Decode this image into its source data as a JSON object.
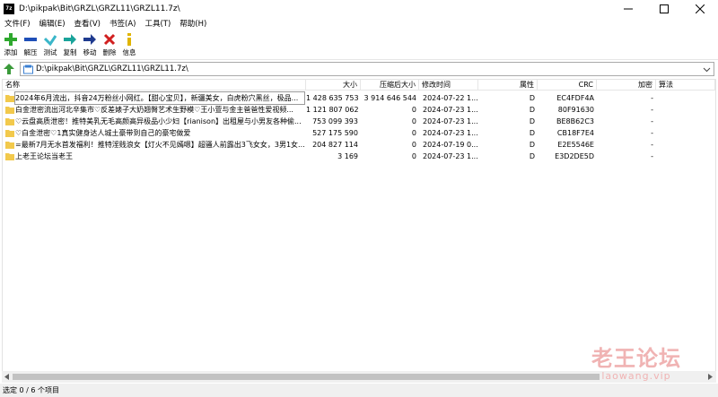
{
  "window": {
    "app_icon": "7z",
    "title": "D:\\pikpak\\Bit\\GRZL\\GRZL11\\GRZL11.7z\\"
  },
  "menu": [
    "文件(F)",
    "编辑(E)",
    "查看(V)",
    "书签(A)",
    "工具(T)",
    "帮助(H)"
  ],
  "toolbar": [
    {
      "label": "添加",
      "icon": "add-icon",
      "color": "#2ea82e"
    },
    {
      "label": "解压",
      "icon": "extract-icon",
      "color": "#1f4fb8"
    },
    {
      "label": "测试",
      "icon": "test-icon",
      "color": "#3ab6c9"
    },
    {
      "label": "复制",
      "icon": "copy-icon",
      "color": "#1aa39a"
    },
    {
      "label": "移动",
      "icon": "move-icon",
      "color": "#1f3b8f"
    },
    {
      "label": "删除",
      "icon": "delete-icon",
      "color": "#d11f1f"
    },
    {
      "label": "信息",
      "icon": "info-icon",
      "color": "#e0b400"
    }
  ],
  "address": {
    "path": "D:\\pikpak\\Bit\\GRZL\\GRZL11\\GRZL11.7z\\"
  },
  "columns": [
    "名称",
    "大小",
    "压缩后大小",
    "修改时间",
    "属性",
    "CRC",
    "加密",
    "算法"
  ],
  "rows": [
    {
      "name": "2024年6月流出，抖音24万粉丝小网红。【甜心宝贝】，新疆美女，白虎粉穴黑丝，极品...",
      "size": "1 428 635 753",
      "packed": "3 914 646 544",
      "modified": "2024-07-22 1...",
      "attr": "D",
      "crc": "EC4FDF4A",
      "encrypted": "-",
      "method": ""
    },
    {
      "name": "白金泄密流出河北辛集市♡反差婊子大奶翘臀艺术生野模♡王小萱与金主爸爸性爱视频...",
      "size": "1 121 807 062",
      "packed": "0",
      "modified": "2024-07-23 1...",
      "attr": "D",
      "crc": "80F91630",
      "encrypted": "-",
      "method": ""
    },
    {
      "name": "♡云盘高质泄密！推特美乳无毛高颜高异极品小少妇【rianison】出租屋与小男友各种偷...",
      "size": "753 099 393",
      "packed": "0",
      "modified": "2024-07-23 1...",
      "attr": "D",
      "crc": "BE8B62C3",
      "encrypted": "-",
      "method": ""
    },
    {
      "name": "♡白金泄密♡1真实健身达人城土豪带到自己的豪宅做爱",
      "size": "527 175 590",
      "packed": "0",
      "modified": "2024-07-23 1...",
      "attr": "D",
      "crc": "CB18F7E4",
      "encrypted": "-",
      "method": ""
    },
    {
      "name": "=最新7月无水首发福利！推特淫贱浪女【灯火不见嫣嗯】超骚人前露出3飞女女，3男1女...",
      "size": "204 827 114",
      "packed": "0",
      "modified": "2024-07-19 0...",
      "attr": "D",
      "crc": "E2E5546E",
      "encrypted": "-",
      "method": ""
    },
    {
      "name": "上老王论坛当老王",
      "size": "3 169",
      "packed": "0",
      "modified": "2024-07-23 1...",
      "attr": "D",
      "crc": "E3D2DE5D",
      "encrypted": "-",
      "method": ""
    }
  ],
  "status": {
    "text": "选定 0 / 6 个项目"
  },
  "watermark": {
    "cn": "老王论坛",
    "en": "laowang.vip"
  },
  "colors": {
    "folder": "#f2c94c",
    "selection_border": "#9a9a9a"
  }
}
